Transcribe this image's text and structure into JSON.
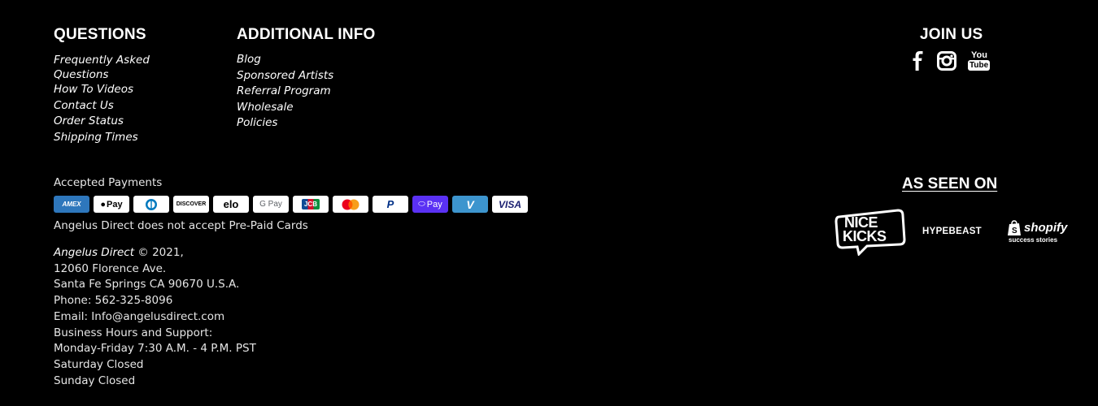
{
  "questions": {
    "heading": "QUESTIONS",
    "links": [
      "Frequently Asked Questions",
      "How To Videos",
      "Contact Us",
      "Order Status",
      "Shipping Times"
    ]
  },
  "additional": {
    "heading": "ADDITIONAL INFO",
    "links": [
      "Blog",
      "Sponsored Artists",
      "Referral Program",
      "Wholesale",
      "Policies"
    ]
  },
  "join": {
    "heading": "JOIN US",
    "icons": [
      "facebook-icon",
      "instagram-icon",
      "youtube-icon"
    ],
    "youtube_top": "You",
    "youtube_bottom": "Tube"
  },
  "payments": {
    "label": "Accepted Payments",
    "methods": [
      {
        "name": "amex",
        "text": "AMEX",
        "bg": "#2e77bc",
        "fg": "#ffffff"
      },
      {
        "name": "apple-pay",
        "text": "Pay",
        "bg": "#ffffff",
        "fg": "#000000"
      },
      {
        "name": "diners",
        "text": "",
        "bg": "#ffffff",
        "fg": "#0079be"
      },
      {
        "name": "discover",
        "text": "DISCOVER",
        "bg": "#ffffff",
        "fg": "#000000"
      },
      {
        "name": "elo",
        "text": "elo",
        "bg": "#ffffff",
        "fg": "#000000"
      },
      {
        "name": "google-pay",
        "text": "G Pay",
        "bg": "#ffffff",
        "fg": "#5f6368"
      },
      {
        "name": "jcb",
        "text": "JCB",
        "bg": "#ffffff",
        "fg": "#0e4c96"
      },
      {
        "name": "mastercard",
        "text": "",
        "bg": "#ffffff",
        "fg": "#eb001b"
      },
      {
        "name": "paypal",
        "text": "P",
        "bg": "#ffffff",
        "fg": "#003087"
      },
      {
        "name": "shop-pay",
        "text": "Pay",
        "bg": "#5a31f4",
        "fg": "#ffffff"
      },
      {
        "name": "venmo",
        "text": "V",
        "bg": "#3d95ce",
        "fg": "#ffffff"
      },
      {
        "name": "visa",
        "text": "VISA",
        "bg": "#ffffff",
        "fg": "#1a1f71"
      }
    ],
    "note": "Angelus Direct does not accept Pre-Paid Cards"
  },
  "address": {
    "brand": "Angelus Direct",
    "copyright": " © 2021,",
    "lines": [
      "12060 Florence Ave.",
      "Santa Fe Springs CA 90670 U.S.A.",
      "Phone: 562-325-8096",
      "Email: Info@angelusdirect.com",
      "Business Hours and Support:",
      "Monday-Friday 7:30 A.M. - 4 P.M. PST",
      "Saturday Closed",
      "Sunday Closed"
    ]
  },
  "seen_on": {
    "heading": "AS SEEN ON",
    "nice": "NICE",
    "kicks": "KICKS",
    "hypebeast": "HYPEBEAST",
    "shopify": "shopify",
    "shopify_sub": "success stories"
  },
  "colors": {
    "background": "#000000",
    "text": "#ffffff",
    "muted_text": "#e6e6e6"
  }
}
